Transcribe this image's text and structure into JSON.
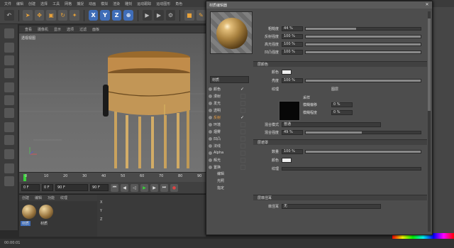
{
  "menubar": [
    "文件",
    "编辑",
    "创建",
    "选择",
    "工具",
    "网格",
    "捕捉",
    "动画",
    "模拟",
    "渲染",
    "雕刻",
    "运动跟踪",
    "运动图形",
    "角色"
  ],
  "viewport": {
    "menu": [
      "查看",
      "摄像机",
      "显示",
      "选项",
      "过滤",
      "面板"
    ],
    "label": "透视视图"
  },
  "timeline": {
    "ticks": [
      "0",
      "10",
      "20",
      "30",
      "40",
      "50",
      "60",
      "70",
      "80",
      "90"
    ]
  },
  "transport": {
    "start": "0 F",
    "current": "0 F",
    "mid": "90 F",
    "end": "90 F"
  },
  "material_manager": {
    "menu": [
      "创建",
      "编辑",
      "功能",
      "纹理"
    ],
    "items": [
      "材质",
      "材质"
    ]
  },
  "coord_panel": [
    "X",
    "Y",
    "Z"
  ],
  "statusbar": {
    "time": "00:00:01"
  },
  "editor": {
    "title": "材质编辑器",
    "material_name": "材质",
    "channels": [
      {
        "label": "颜色",
        "checked": true
      },
      {
        "label": "漫射",
        "checked": false
      },
      {
        "label": "发光",
        "checked": false
      },
      {
        "label": "透明",
        "checked": false
      },
      {
        "label": "反射",
        "checked": true,
        "active": true
      },
      {
        "label": "环境",
        "checked": false
      },
      {
        "label": "烟雾",
        "checked": false
      },
      {
        "label": "凹凸",
        "checked": false
      },
      {
        "label": "法线",
        "checked": false
      },
      {
        "label": "Alpha",
        "checked": false
      },
      {
        "label": "辉光",
        "checked": false
      },
      {
        "label": "置换",
        "checked": false
      }
    ],
    "extra": [
      "编辑",
      "光照",
      "指定"
    ],
    "props": {
      "roughness": {
        "label": "粗糙度",
        "value": "44 %",
        "level": 0.44
      },
      "reflect_strength": {
        "label": "反射强度",
        "value": "100 %",
        "level": 1.0
      },
      "spec_strength": {
        "label": "高光强度",
        "value": "100 %",
        "level": 1.0
      },
      "bump_strength": {
        "label": "凹凸强度",
        "value": "100 %",
        "level": 1.0
      }
    },
    "section_layer_color": "层颜色",
    "color_label": "颜色",
    "brightness_label": "亮度",
    "brightness_value": "100 %",
    "texture_label": "纹理",
    "texture_sub": "图层",
    "sample_label": "采样",
    "blur_offset_label": "模糊偏移",
    "blur_offset_value": "0 %",
    "blur_scale_label": "模糊程度",
    "blur_scale_value": "0 %",
    "mix_mode_label": "混合模式",
    "mix_mode_value": "普通",
    "mix_strength_label": "混合强度",
    "mix_strength_value": "49 %",
    "mix_strength_level": 0.49,
    "section_layer_mask": "层遮罩",
    "mask_amount_label": "数量",
    "mask_amount_value": "100 %",
    "mask_color_label": "颜色",
    "mask_texture_label": "纹理",
    "section_layer_fresnel": "层菲涅耳",
    "fresnel_label": "菲涅耳",
    "fresnel_value": "无"
  }
}
